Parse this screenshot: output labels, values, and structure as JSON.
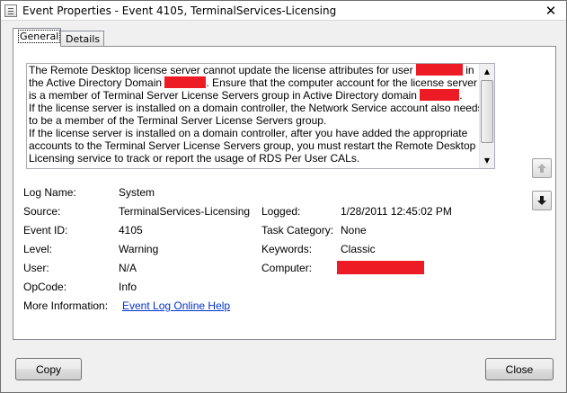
{
  "window": {
    "title": "Event Properties - Event 4105, TerminalServices-Licensing",
    "close_glyph": "✕"
  },
  "tabs": [
    {
      "label": "General",
      "selected": true
    },
    {
      "label": "Details",
      "selected": false
    }
  ],
  "description": {
    "lines": [
      [
        "The Remote Desktop license server cannot update the license attributes for user ",
        "in"
      ],
      [
        "the Active Directory Domain ",
        ". Ensure that the computer account for the license server"
      ],
      [
        "is a member of Terminal Server License Servers group in Active Directory domain ",
        "."
      ],
      [
        "If the license server is installed on a domain controller, the Network Service account also needs"
      ],
      [
        "to be a member of the Terminal Server License Servers group."
      ],
      [
        "If the license server is installed on a domain controller, after you have added the appropriate"
      ],
      [
        "accounts to the Terminal Server License Servers group, you must restart the Remote Desktop"
      ],
      [
        "Licensing service to track or report the usage of RDS Per User CALs."
      ]
    ],
    "redaction_color": "#ed1c24"
  },
  "properties": {
    "log_name_label": "Log Name:",
    "log_name_value": "System",
    "source_label": "Source:",
    "source_value": "TerminalServices-Licensing",
    "logged_label": "Logged:",
    "logged_value": "1/28/2011 12:45:02 PM",
    "event_id_label": "Event ID:",
    "event_id_value": "4105",
    "task_category_label": "Task Category:",
    "task_category_value": "None",
    "level_label": "Level:",
    "level_value": "Warning",
    "keywords_label": "Keywords:",
    "keywords_value": "Classic",
    "user_label": "User:",
    "user_value": "N/A",
    "computer_label": "Computer:",
    "opcode_label": "OpCode:",
    "opcode_value": "Info",
    "more_info_label": "More Information:",
    "more_info_link": "Event Log Online Help"
  },
  "buttons": {
    "copy": "Copy",
    "close": "Close"
  },
  "icons": {
    "previous": "arrow-up-icon",
    "next": "arrow-down-icon",
    "scroll_up": "scroll-up-icon",
    "scroll_down": "scroll-down-icon"
  }
}
